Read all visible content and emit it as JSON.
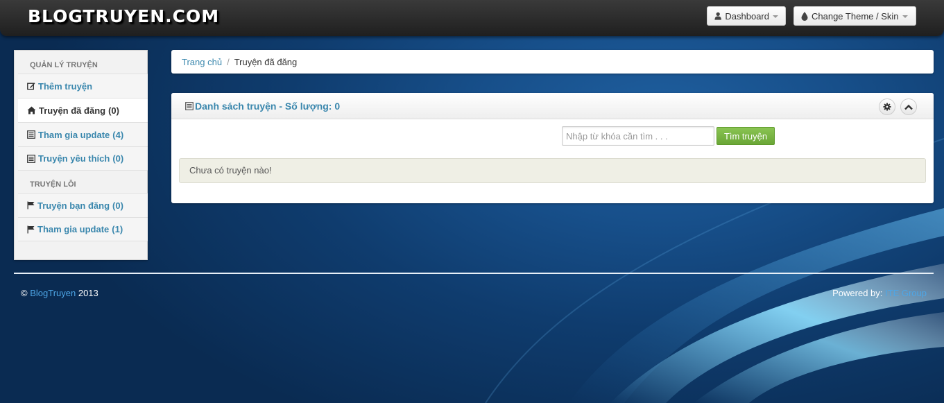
{
  "header": {
    "logo": "BLOGTRUYEN.COM",
    "dashboard_label": "Dashboard",
    "theme_label": "Change Theme / Skin"
  },
  "sidebar": {
    "section1_title": "QUẢN LÝ TRUYỆN",
    "items1": [
      {
        "label": "Thêm truyện",
        "count": "",
        "icon": "edit-icon"
      },
      {
        "label": "Truyện đã đăng",
        "count": "(0)",
        "icon": "home-icon",
        "active": true
      },
      {
        "label": "Tham gia update",
        "count": "(4)",
        "icon": "list-icon"
      },
      {
        "label": "Truyện yêu thích",
        "count": "(0)",
        "icon": "list-icon"
      }
    ],
    "section2_title": "TRUYỆN LỖI",
    "items2": [
      {
        "label": "Truyện bạn đăng",
        "count": "(0)",
        "icon": "flag-icon"
      },
      {
        "label": "Tham gia update",
        "count": "(1)",
        "icon": "flag-icon"
      }
    ]
  },
  "breadcrumb": {
    "home": "Trang chủ",
    "separator": "/",
    "current": "Truyện đã đăng"
  },
  "panel": {
    "title": "Danh sách truyện - Số lượng: 0",
    "search_placeholder": "Nhập từ khóa cần tìm . . .",
    "search_button": "Tìm truyện",
    "empty_message": "Chưa có truyện nào!"
  },
  "footer": {
    "copyright_symbol": "©",
    "brand": "BlogTruyen",
    "year": "2013",
    "powered_label": "Powered by:",
    "powered_by": "ITE Group"
  },
  "colors": {
    "link": "#3a87ad",
    "accent_green": "#7ab648",
    "footer_link": "#4ea6e6"
  }
}
